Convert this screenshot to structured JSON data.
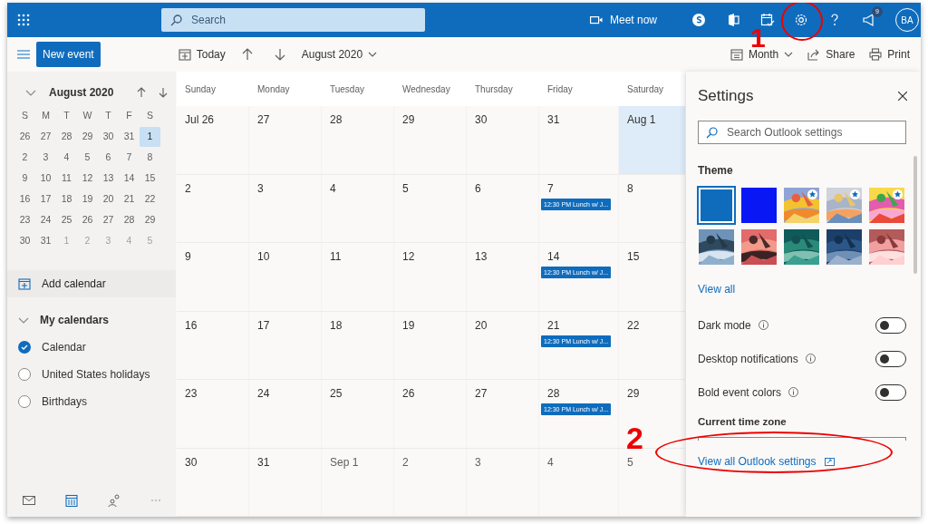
{
  "topbar": {
    "search_placeholder": "Search",
    "meet_now": "Meet now",
    "notification_count": "9",
    "avatar": "BA"
  },
  "commandbar": {
    "new_event": "New event",
    "today": "Today",
    "month_label": "August 2020",
    "view": "Month",
    "share": "Share",
    "print": "Print"
  },
  "mini_calendar": {
    "title": "August 2020",
    "weekdays": [
      "S",
      "M",
      "T",
      "W",
      "T",
      "F",
      "S"
    ],
    "weeks": [
      [
        {
          "day": "26",
          "muted": false,
          "selected": false
        },
        {
          "day": "27",
          "muted": false,
          "selected": false
        },
        {
          "day": "28",
          "muted": false,
          "selected": false
        },
        {
          "day": "29",
          "muted": false,
          "selected": false
        },
        {
          "day": "30",
          "muted": false,
          "selected": false
        },
        {
          "day": "31",
          "muted": false,
          "selected": false
        },
        {
          "day": "1",
          "muted": false,
          "selected": true
        }
      ],
      [
        {
          "day": "2",
          "muted": false,
          "selected": false
        },
        {
          "day": "3",
          "muted": false,
          "selected": false
        },
        {
          "day": "4",
          "muted": false,
          "selected": false
        },
        {
          "day": "5",
          "muted": false,
          "selected": false
        },
        {
          "day": "6",
          "muted": false,
          "selected": false
        },
        {
          "day": "7",
          "muted": false,
          "selected": false
        },
        {
          "day": "8",
          "muted": false,
          "selected": false
        }
      ],
      [
        {
          "day": "9",
          "muted": false,
          "selected": false
        },
        {
          "day": "10",
          "muted": false,
          "selected": false
        },
        {
          "day": "11",
          "muted": false,
          "selected": false
        },
        {
          "day": "12",
          "muted": false,
          "selected": false
        },
        {
          "day": "13",
          "muted": false,
          "selected": false
        },
        {
          "day": "14",
          "muted": false,
          "selected": false
        },
        {
          "day": "15",
          "muted": false,
          "selected": false
        }
      ],
      [
        {
          "day": "16",
          "muted": false,
          "selected": false
        },
        {
          "day": "17",
          "muted": false,
          "selected": false
        },
        {
          "day": "18",
          "muted": false,
          "selected": false
        },
        {
          "day": "19",
          "muted": false,
          "selected": false
        },
        {
          "day": "20",
          "muted": false,
          "selected": false
        },
        {
          "day": "21",
          "muted": false,
          "selected": false
        },
        {
          "day": "22",
          "muted": false,
          "selected": false
        }
      ],
      [
        {
          "day": "23",
          "muted": false,
          "selected": false
        },
        {
          "day": "24",
          "muted": false,
          "selected": false
        },
        {
          "day": "25",
          "muted": false,
          "selected": false
        },
        {
          "day": "26",
          "muted": false,
          "selected": false
        },
        {
          "day": "27",
          "muted": false,
          "selected": false
        },
        {
          "day": "28",
          "muted": false,
          "selected": false
        },
        {
          "day": "29",
          "muted": false,
          "selected": false
        }
      ],
      [
        {
          "day": "30",
          "muted": false,
          "selected": false
        },
        {
          "day": "31",
          "muted": false,
          "selected": false
        },
        {
          "day": "1",
          "muted": true,
          "selected": false
        },
        {
          "day": "2",
          "muted": true,
          "selected": false
        },
        {
          "day": "3",
          "muted": true,
          "selected": false
        },
        {
          "day": "4",
          "muted": true,
          "selected": false
        },
        {
          "day": "5",
          "muted": true,
          "selected": false
        }
      ]
    ]
  },
  "add_calendar": "Add calendar",
  "my_calendars": {
    "title": "My calendars",
    "expanded": true,
    "items": [
      {
        "label": "Calendar",
        "checked": true
      },
      {
        "label": "United States holidays",
        "checked": false
      },
      {
        "label": "Birthdays",
        "checked": false
      }
    ]
  },
  "month_grid": {
    "weekdays": [
      "Sunday",
      "Monday",
      "Tuesday",
      "Wednesday",
      "Thursday",
      "Friday",
      "Saturday"
    ],
    "weeks": [
      [
        {
          "label": "Jul 26",
          "selected": false,
          "muted": false
        },
        {
          "label": "27",
          "selected": false,
          "muted": false
        },
        {
          "label": "28",
          "selected": false,
          "muted": false
        },
        {
          "label": "29",
          "selected": false,
          "muted": false
        },
        {
          "label": "30",
          "selected": false,
          "muted": false
        },
        {
          "label": "31",
          "selected": false,
          "muted": false
        },
        {
          "label": "Aug 1",
          "selected": true,
          "muted": false
        }
      ],
      [
        {
          "label": "2",
          "selected": false,
          "muted": false
        },
        {
          "label": "3",
          "selected": false,
          "muted": false
        },
        {
          "label": "4",
          "selected": false,
          "muted": false
        },
        {
          "label": "5",
          "selected": false,
          "muted": false
        },
        {
          "label": "6",
          "selected": false,
          "muted": false
        },
        {
          "label": "7",
          "selected": false,
          "muted": false,
          "events": [
            "12:30 PM Lunch w/ J..."
          ]
        },
        {
          "label": "8",
          "selected": false,
          "muted": false
        }
      ],
      [
        {
          "label": "9",
          "selected": false,
          "muted": false
        },
        {
          "label": "10",
          "selected": false,
          "muted": false
        },
        {
          "label": "11",
          "selected": false,
          "muted": false
        },
        {
          "label": "12",
          "selected": false,
          "muted": false
        },
        {
          "label": "13",
          "selected": false,
          "muted": false
        },
        {
          "label": "14",
          "selected": false,
          "muted": false,
          "events": [
            "12:30 PM Lunch w/ J..."
          ]
        },
        {
          "label": "15",
          "selected": false,
          "muted": false
        }
      ],
      [
        {
          "label": "16",
          "selected": false,
          "muted": false
        },
        {
          "label": "17",
          "selected": false,
          "muted": false
        },
        {
          "label": "18",
          "selected": false,
          "muted": false
        },
        {
          "label": "19",
          "selected": false,
          "muted": false
        },
        {
          "label": "20",
          "selected": false,
          "muted": false
        },
        {
          "label": "21",
          "selected": false,
          "muted": false,
          "events": [
            "12:30 PM Lunch w/ J..."
          ]
        },
        {
          "label": "22",
          "selected": false,
          "muted": false
        }
      ],
      [
        {
          "label": "23",
          "selected": false,
          "muted": false
        },
        {
          "label": "24",
          "selected": false,
          "muted": false
        },
        {
          "label": "25",
          "selected": false,
          "muted": false
        },
        {
          "label": "26",
          "selected": false,
          "muted": false
        },
        {
          "label": "27",
          "selected": false,
          "muted": false
        },
        {
          "label": "28",
          "selected": false,
          "muted": false,
          "events": [
            "12:30 PM Lunch w/ J..."
          ]
        },
        {
          "label": "29",
          "selected": false,
          "muted": false
        }
      ],
      [
        {
          "label": "30",
          "selected": false,
          "muted": false
        },
        {
          "label": "31",
          "selected": false,
          "muted": false
        },
        {
          "label": "Sep 1",
          "selected": false,
          "muted": true
        },
        {
          "label": "2",
          "selected": false,
          "muted": true
        },
        {
          "label": "3",
          "selected": false,
          "muted": true
        },
        {
          "label": "4",
          "selected": false,
          "muted": true
        },
        {
          "label": "5",
          "selected": false,
          "muted": true
        }
      ]
    ]
  },
  "settings": {
    "title": "Settings",
    "search_placeholder": "Search Outlook settings",
    "theme_label": "Theme",
    "themes": [
      {
        "kind": "solid",
        "color": "#0f6cbd",
        "selected": true,
        "featured": false
      },
      {
        "kind": "solid",
        "color": "#0a17f5",
        "selected": false,
        "featured": false
      },
      {
        "kind": "picture",
        "selected": false,
        "featured": true
      },
      {
        "kind": "picture",
        "selected": false,
        "featured": true
      },
      {
        "kind": "picture",
        "selected": false,
        "featured": true
      },
      {
        "kind": "picture",
        "selected": false,
        "featured": false
      },
      {
        "kind": "picture",
        "selected": false,
        "featured": false
      },
      {
        "kind": "picture",
        "selected": false,
        "featured": false
      },
      {
        "kind": "picture",
        "selected": false,
        "featured": false
      },
      {
        "kind": "picture",
        "selected": false,
        "featured": false
      }
    ],
    "view_all": "View all",
    "toggles": [
      {
        "label": "Dark mode",
        "on": false
      },
      {
        "label": "Desktop notifications",
        "on": false
      },
      {
        "label": "Bold event colors",
        "on": false
      }
    ],
    "time_zone_label": "Current time zone",
    "all_settings_link": "View all Outlook settings"
  },
  "annotations": [
    {
      "label": "1"
    },
    {
      "label": "2"
    }
  ]
}
